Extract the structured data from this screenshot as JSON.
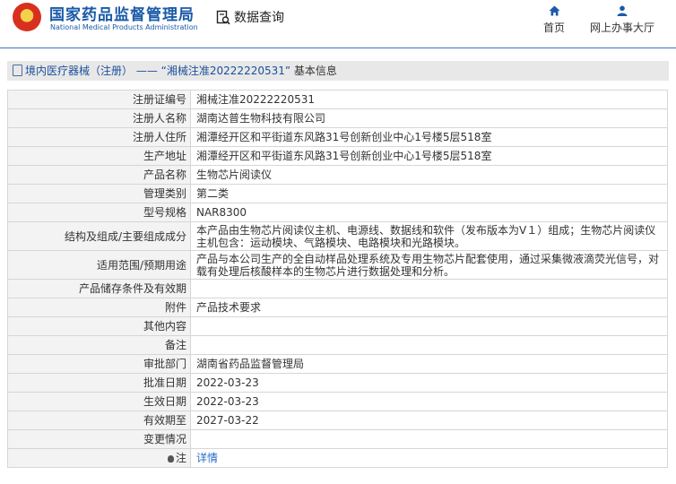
{
  "header": {
    "logo_cn": "国家药品监督管理局",
    "logo_en": "National Medical Products Administration",
    "search_label": "数据查询",
    "nav": {
      "home": "首页",
      "hall": "网上办事大厅"
    }
  },
  "breadcrumb": {
    "section": "境内医疗器械（注册）",
    "separator": "——",
    "record": "“湘械注准20222220531”",
    "suffix": "基本信息"
  },
  "rows": [
    {
      "label": "注册证编号",
      "value": "湘械注准20222220531"
    },
    {
      "label": "注册人名称",
      "value": "湖南达普生物科技有限公司"
    },
    {
      "label": "注册人住所",
      "value": "湘潭经开区和平街道东风路31号创新创业中心1号楼5层518室"
    },
    {
      "label": "生产地址",
      "value": "湘潭经开区和平街道东风路31号创新创业中心1号楼5层518室"
    },
    {
      "label": "产品名称",
      "value": "生物芯片阅读仪"
    },
    {
      "label": "管理类别",
      "value": "第二类"
    },
    {
      "label": "型号规格",
      "value": "NAR8300"
    },
    {
      "label": "结构及组成/主要组成成分",
      "value": "本产品由生物芯片阅读仪主机、电源线、数据线和软件（发布版本为V１）组成；生物芯片阅读仪主机包含：运动模块、气路模块、电路模块和光路模块。"
    },
    {
      "label": "适用范围/预期用途",
      "value": "产品与本公司生产的全自动样品处理系统及专用生物芯片配套使用，通过采集微液滴荧光信号，对载有处理后核酸样本的生物芯片进行数据处理和分析。"
    },
    {
      "label": "产品储存条件及有效期",
      "value": ""
    },
    {
      "label": "附件",
      "value": "产品技术要求"
    },
    {
      "label": "其他内容",
      "value": ""
    },
    {
      "label": "备注",
      "value": ""
    },
    {
      "label": "审批部门",
      "value": "湖南省药品监督管理局"
    },
    {
      "label": "批准日期",
      "value": "2022-03-23"
    },
    {
      "label": "生效日期",
      "value": "2022-03-23"
    },
    {
      "label": "有效期至",
      "value": "2027-03-22"
    },
    {
      "label": "变更情况",
      "value": ""
    }
  ],
  "note": {
    "label": "注",
    "link": "详情",
    "icon": "bulb-icon"
  },
  "colors": {
    "brand": "#1a5aa8",
    "link": "#2a6cc8",
    "label_bg": "#f3f3f3",
    "crumb_bg": "#e8e8e8"
  }
}
